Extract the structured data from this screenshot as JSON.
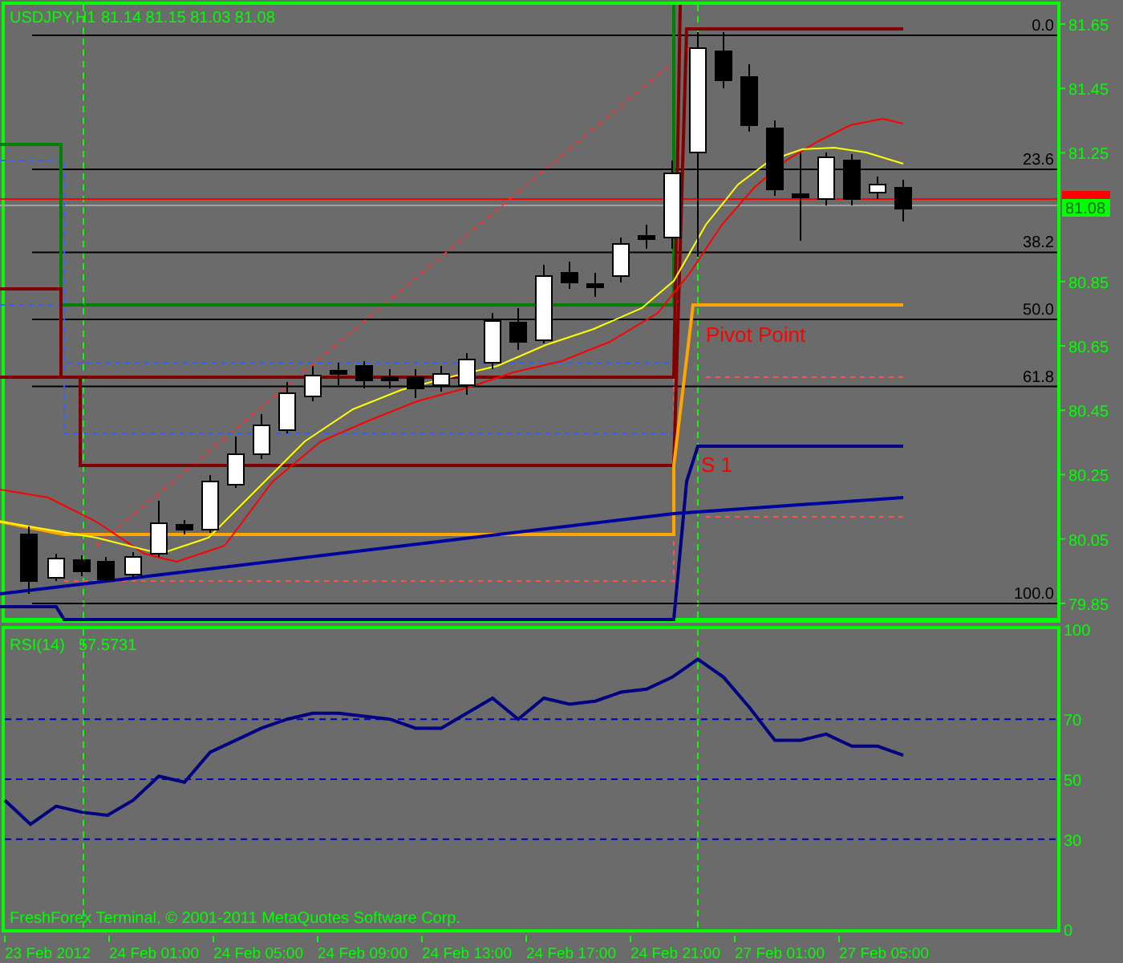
{
  "header": {
    "symbol": "USDJPY,H1",
    "quote": "81.14 81.15 81.03 81.08"
  },
  "price_axis": {
    "ticks": [
      "81.65",
      "81.45",
      "81.25",
      "80.85",
      "80.65",
      "80.45",
      "80.25",
      "80.05",
      "79.85"
    ],
    "current_price": "81.08"
  },
  "fibonacci_levels": [
    "0.0",
    "23.6",
    "38.2",
    "50.0",
    "61.8",
    "100.0"
  ],
  "pivot_labels": [
    {
      "kind": "pivot",
      "label": "Pivot Point"
    },
    {
      "kind": "support",
      "label": "S 1"
    }
  ],
  "rsi_panel": {
    "reading": "57.5731",
    "chart_data": {
      "type": "line",
      "grid": true,
      "ylim": [
        0,
        100
      ],
      "yticks": [
        0,
        30,
        50,
        70,
        100
      ],
      "series": [
        {
          "name": "RSI(14)",
          "color": "#000080",
          "values": [
            43,
            35,
            41,
            39,
            38,
            43,
            51,
            49,
            59,
            63,
            67,
            70,
            72,
            72,
            71,
            70,
            67,
            67,
            72,
            77,
            70,
            77,
            75,
            76,
            79,
            80,
            84,
            90,
            84,
            74,
            63,
            63,
            65,
            61,
            61,
            58
          ]
        }
      ]
    }
  },
  "footer": "FreshForex Terminal, © 2001-2011 MetaQuotes Software Corp.",
  "time_axis": [
    "23 Feb 2012",
    "24 Feb 01:00",
    "24 Feb 05:00",
    "24 Feb 09:00",
    "24 Feb 13:00",
    "24 Feb 17:00",
    "24 Feb 21:00",
    "27 Feb 01:00",
    "27 Feb 05:00"
  ]
}
